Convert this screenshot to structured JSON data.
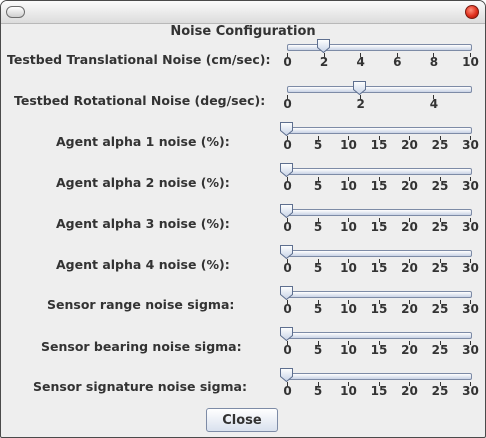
{
  "dialog": {
    "title": "Noise Configuration",
    "close_label": "Close"
  },
  "sliders": [
    {
      "label": "Testbed Translational Noise (cm/sec):",
      "min": 0,
      "max": 10,
      "value": 2,
      "ticks": [
        "0",
        "2",
        "4",
        "6",
        "8",
        "10"
      ]
    },
    {
      "label": "Testbed Rotational Noise (deg/sec):",
      "min": 0,
      "max": 5,
      "value": 2,
      "ticks": [
        "0",
        "2",
        "4"
      ]
    },
    {
      "label": "Agent alpha 1 noise (%):",
      "min": 0,
      "max": 30,
      "value": 0,
      "ticks": [
        "0",
        "5",
        "10",
        "15",
        "20",
        "25",
        "30"
      ]
    },
    {
      "label": "Agent alpha 2 noise (%):",
      "min": 0,
      "max": 30,
      "value": 0,
      "ticks": [
        "0",
        "5",
        "10",
        "15",
        "20",
        "25",
        "30"
      ]
    },
    {
      "label": "Agent alpha 3 noise (%):",
      "min": 0,
      "max": 30,
      "value": 0,
      "ticks": [
        "0",
        "5",
        "10",
        "15",
        "20",
        "25",
        "30"
      ]
    },
    {
      "label": "Agent alpha 4 noise (%):",
      "min": 0,
      "max": 30,
      "value": 0,
      "ticks": [
        "0",
        "5",
        "10",
        "15",
        "20",
        "25",
        "30"
      ]
    },
    {
      "label": "Sensor range noise sigma:",
      "min": 0,
      "max": 30,
      "value": 0,
      "ticks": [
        "0",
        "5",
        "10",
        "15",
        "20",
        "25",
        "30"
      ]
    },
    {
      "label": "Sensor bearing noise sigma:",
      "min": 0,
      "max": 30,
      "value": 0,
      "ticks": [
        "0",
        "5",
        "10",
        "15",
        "20",
        "25",
        "30"
      ]
    },
    {
      "label": "Sensor signature noise sigma:",
      "min": 0,
      "max": 30,
      "value": 0,
      "ticks": [
        "0",
        "5",
        "10",
        "15",
        "20",
        "25",
        "30"
      ]
    }
  ]
}
